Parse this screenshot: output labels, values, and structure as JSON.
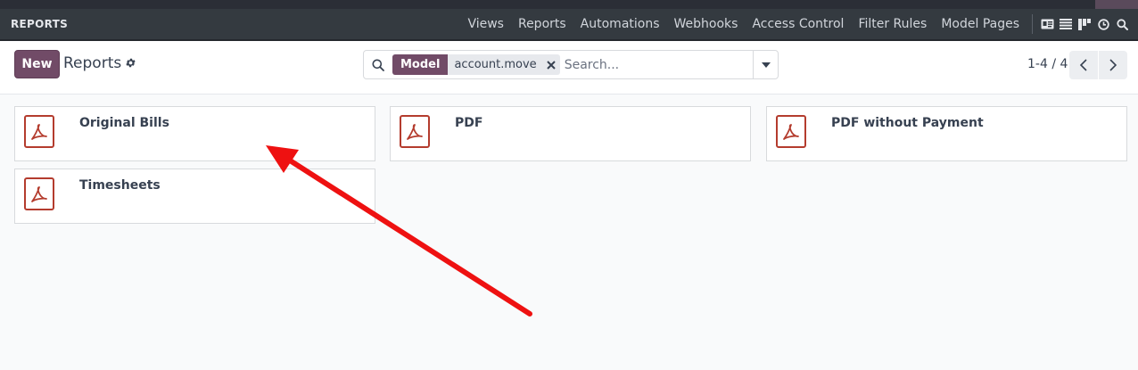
{
  "navbar": {
    "app_title": "REPORTS",
    "menu": [
      "Views",
      "Reports",
      "Automations",
      "Webhooks",
      "Access Control",
      "Filter Rules",
      "Model Pages"
    ]
  },
  "view_icons": [
    "id-card-icon",
    "list-icon",
    "kanban-icon",
    "clock-icon",
    "search-icon"
  ],
  "control": {
    "new_label": "New",
    "breadcrumb": "Reports"
  },
  "search": {
    "facet_label": "Model",
    "facet_value": "account.move",
    "placeholder": "Search..."
  },
  "pager": {
    "value": "1-4 / 4"
  },
  "cards": [
    {
      "name": "Original Bills"
    },
    {
      "name": "PDF"
    },
    {
      "name": "PDF without Payment"
    },
    {
      "name": "Timesheets"
    }
  ],
  "colors": {
    "brand": "#714b67",
    "navbar": "#343a40",
    "pdf_icon": "#b43c2e",
    "annotation": "#ee1111"
  }
}
